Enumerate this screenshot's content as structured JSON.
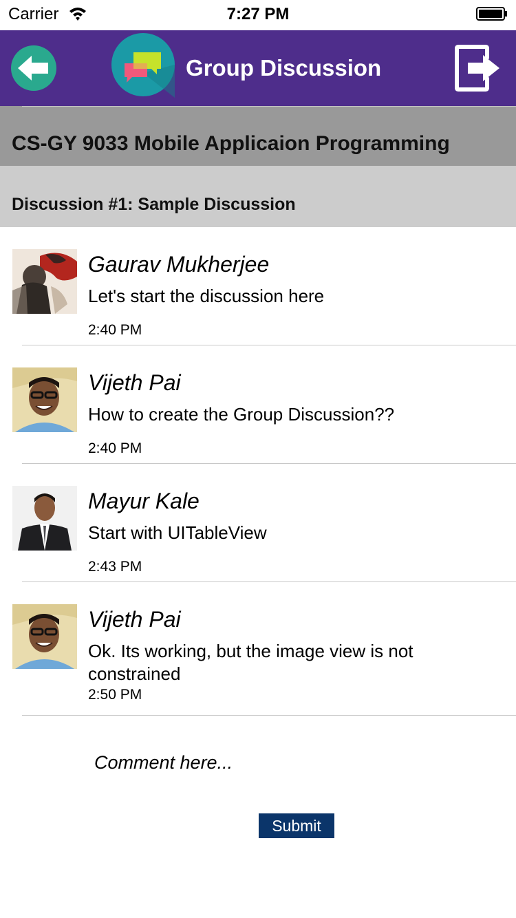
{
  "status_bar": {
    "carrier": "Carrier",
    "time": "7:27 PM"
  },
  "nav": {
    "title": "Group Discussion",
    "colors": {
      "background": "#4e2d8b",
      "back_button": "#2aa98e",
      "logo_circle": "#1b9aa6"
    },
    "icons": {
      "back": "back-arrow-icon",
      "logo": "chat-bubbles-icon",
      "logout": "logout-icon"
    }
  },
  "course": {
    "title": "CS-GY 9033 Mobile Applicaion Programming"
  },
  "discussion": {
    "title": "Discussion #1: Sample Discussion"
  },
  "messages": [
    {
      "author": "Gaurav Mukherjee",
      "text": "Let's start the discussion here",
      "time": "2:40 PM",
      "avatar": "avatar-gaurav-mukherjee"
    },
    {
      "author": "Vijeth Pai",
      "text": "How to create the Group Discussion??",
      "time": "2:40 PM",
      "avatar": "avatar-vijeth-pai"
    },
    {
      "author": "Mayur Kale",
      "text": "Start with UITableView",
      "time": "2:43 PM",
      "avatar": "avatar-mayur-kale"
    },
    {
      "author": "Vijeth Pai",
      "text": "Ok. Its working, but the image view is not constrained",
      "time": "2:50 PM",
      "avatar": "avatar-vijeth-pai"
    }
  ],
  "composer": {
    "placeholder": "Comment here...",
    "submit_label": "Submit",
    "submit_color": "#0b356a"
  }
}
